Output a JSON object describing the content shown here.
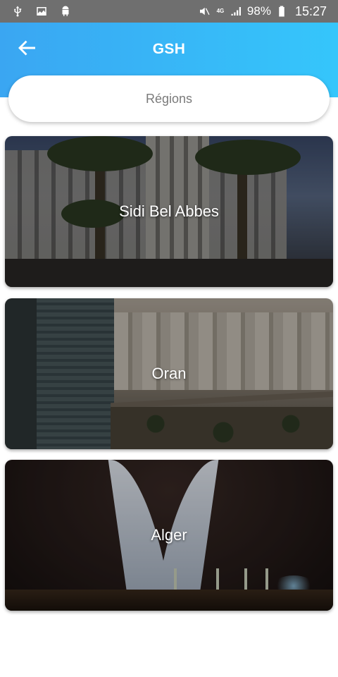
{
  "status_bar": {
    "left_icons": [
      "usb-icon",
      "image-icon",
      "android-icon"
    ],
    "right_icons": [
      "mute-icon",
      "lte-icon",
      "signal-icon",
      "battery-icon"
    ],
    "network": "4G",
    "battery": "98%",
    "time": "15:27"
  },
  "app_bar": {
    "back_icon": "arrow-left-icon",
    "title": "GSH",
    "colors": {
      "start": "#3aa6f2",
      "end": "#35c6fb"
    }
  },
  "search": {
    "label": "Régions"
  },
  "regions": [
    {
      "name": "Sidi Bel Abbes"
    },
    {
      "name": "Oran"
    },
    {
      "name": "Alger"
    }
  ]
}
